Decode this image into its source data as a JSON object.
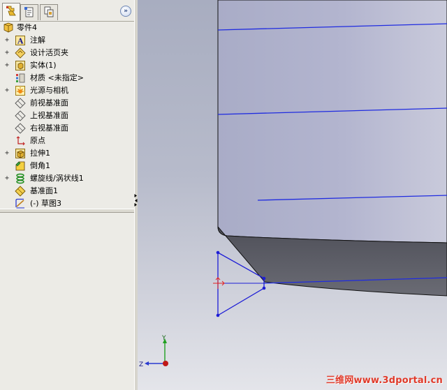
{
  "feature_tree": {
    "root_label": "零件4",
    "items": [
      {
        "label": "注解",
        "icon": "annotation-icon",
        "expandable": true
      },
      {
        "label": "设计活页夹",
        "icon": "design-binder-icon",
        "expandable": true
      },
      {
        "label": "实体(1)",
        "icon": "solid-body-icon",
        "expandable": true
      },
      {
        "label": "材质 <未指定>",
        "icon": "material-icon",
        "expandable": false
      },
      {
        "label": "光源与相机",
        "icon": "lights-cameras-icon",
        "expandable": true
      },
      {
        "label": "前视基准面",
        "icon": "plane-icon",
        "expandable": false
      },
      {
        "label": "上视基准面",
        "icon": "plane-icon",
        "expandable": false
      },
      {
        "label": "右视基准面",
        "icon": "plane-icon",
        "expandable": false
      },
      {
        "label": "原点",
        "icon": "origin-icon",
        "expandable": false
      },
      {
        "label": "拉伸1",
        "icon": "extrude-icon",
        "expandable": true
      },
      {
        "label": "倒角1",
        "icon": "chamfer-icon",
        "expandable": false
      },
      {
        "label": "螺旋线/涡状线1",
        "icon": "helix-icon",
        "expandable": true
      },
      {
        "label": "基准面1",
        "icon": "plane-icon",
        "expandable": false
      },
      {
        "label": "(-) 草图3",
        "icon": "sketch-icon",
        "expandable": false
      }
    ]
  },
  "tabs": [
    {
      "name": "feature-manager-tab",
      "icon": "feature-tree-icon",
      "active": true
    },
    {
      "name": "property-manager-tab",
      "icon": "property-manager-icon",
      "active": false
    },
    {
      "name": "configuration-manager-tab",
      "icon": "configuration-icon",
      "active": false
    }
  ],
  "collapse_button": {
    "glyph": "»"
  },
  "viewport": {
    "triad": {
      "y_label": "Y",
      "z_label": "Z"
    },
    "colors": {
      "model_face": "#a3a6c2",
      "chamfer_face": "#55565f",
      "edge": "#101010",
      "helix": "#1f2be0",
      "sketch": "#1d1dd6",
      "sketch_point_red": "#e22020"
    }
  },
  "watermark": "三维网www.3dportal.cn"
}
